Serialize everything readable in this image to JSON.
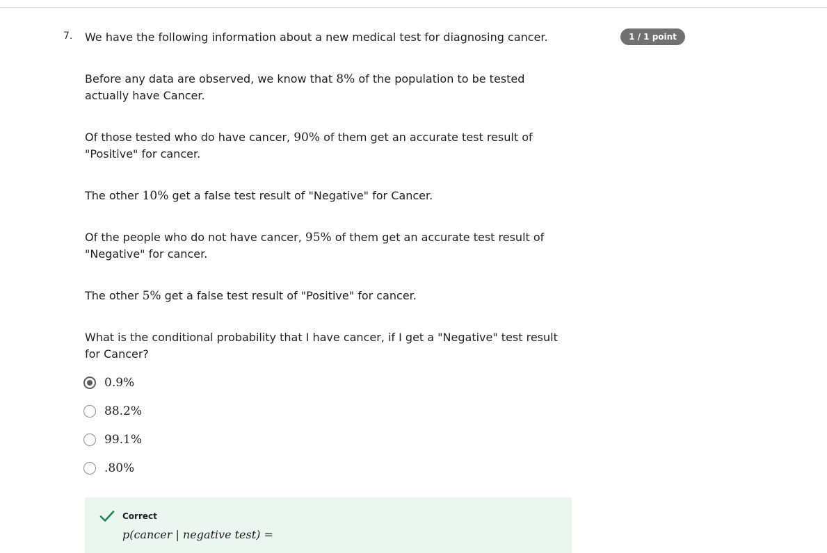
{
  "question": {
    "number": "7.",
    "points_badge": "1 / 1 point",
    "intro": "We have the following information about a new medical test for diagnosing cancer.",
    "p1": {
      "a": "Before any data are observed, we know that ",
      "m": "8%",
      "b": " of the population to be tested actually have Cancer."
    },
    "p2": {
      "a": "Of those tested who do have cancer, ",
      "m": "90%",
      "b": " of them get an accurate test result of \"Positive\" for cancer."
    },
    "p3": {
      "a": "The other ",
      "m": "10%",
      "b": " get a false test result of \"Negative\" for Cancer."
    },
    "p4": {
      "a": "Of the people who do not have cancer, ",
      "m": "95%",
      "b": " of them get an accurate test result of \"Negative\" for cancer."
    },
    "p5": {
      "a": "The other ",
      "m": "5%",
      "b": " get a false test result of \"Positive\" for cancer."
    },
    "prompt": "What is the conditional probability that I have cancer, if I get a \"Negative\" test result for Cancer?"
  },
  "options": [
    {
      "label": "0.9%",
      "selected": true
    },
    {
      "label": "88.2%",
      "selected": false
    },
    {
      "label": "99.1%",
      "selected": false
    },
    {
      "label": ".80%",
      "selected": false
    }
  ],
  "feedback": {
    "status": "Correct",
    "formula": "p(cancer | negative test) =",
    "color": "#1f8354"
  }
}
